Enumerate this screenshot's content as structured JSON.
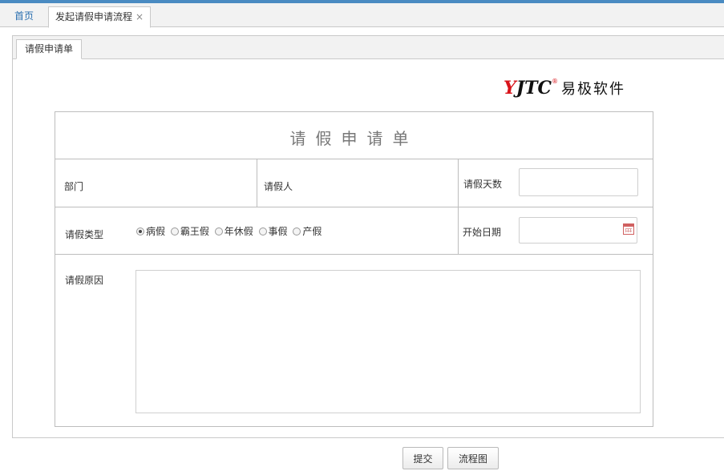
{
  "tabs": {
    "home": "首页",
    "active": "发起请假申请流程",
    "close": "×"
  },
  "panel": {
    "tab_label": "请假申请单"
  },
  "logo": {
    "latin_first": "Y",
    "latin_rest": "JTC",
    "registered": "®",
    "chinese": "易极软件"
  },
  "form": {
    "title": "请假申请单",
    "labels": {
      "department": "部门",
      "applicant": "请假人",
      "days": "请假天数",
      "type": "请假类型",
      "start_date": "开始日期",
      "reason": "请假原因"
    },
    "values": {
      "days": "",
      "start_date": "",
      "reason": ""
    },
    "leave_types": [
      "病假",
      "霸王假",
      "年休假",
      "事假",
      "产假"
    ],
    "selected_type": "病假"
  },
  "buttons": {
    "submit": "提交",
    "flowchart": "流程图"
  },
  "colors": {
    "accent": "#4a8bc2",
    "logo_red": "#d8141b"
  }
}
